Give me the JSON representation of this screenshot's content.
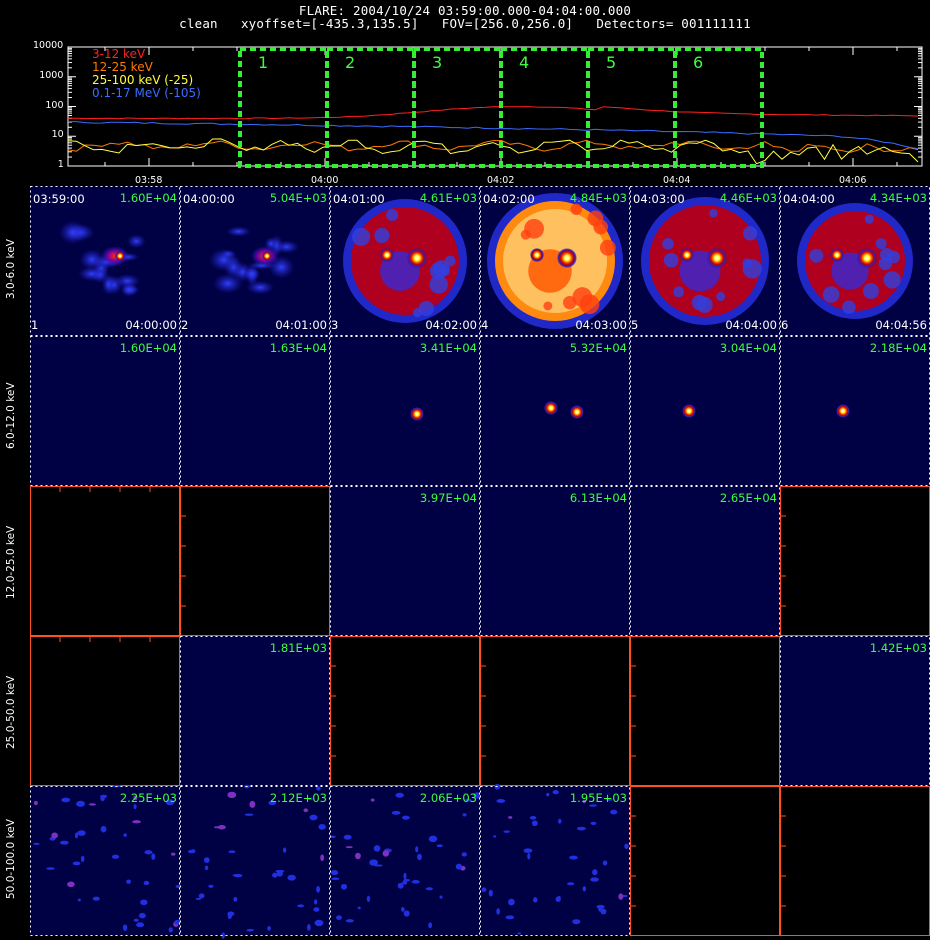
{
  "header": {
    "line1": "FLARE: 2004/10/24 03:59:00.000-04:04:00.000",
    "line2": "clean   xyoffset=[-435.3,135.5]   FOV=[256.0,256.0]   Detectors= 001111111"
  },
  "chart_data": [
    {
      "type": "line",
      "ylim": [
        1,
        10000
      ],
      "yscale": "log",
      "yticks": [
        "10000",
        "1000",
        "100",
        "10",
        "1"
      ],
      "xticks": [
        "03:58",
        "04:00",
        "04:02",
        "04:04",
        "04:06"
      ],
      "series": [
        {
          "name": "3-12 keV",
          "color": "#ff2020"
        },
        {
          "name": "12-25 keV",
          "color": "#ff7a00"
        },
        {
          "name": "25-100 keV (-25)",
          "color": "#ffff40"
        },
        {
          "name": "0.1-17 MeV (-105)",
          "color": "#3a6cff"
        }
      ],
      "windows": [
        "1",
        "2",
        "3",
        "4",
        "5",
        "6"
      ],
      "window_color": "#33ee33"
    },
    {
      "type": "heatmap",
      "row_labels": [
        "3.0-6.0 keV",
        "6.0-12.0 keV",
        "12.0-25.0 keV",
        "25.0-50.0 keV",
        "50.0-100.0 keV"
      ],
      "cells": [
        [
          {
            "peak": "1.60E+04",
            "start": "03:59:00",
            "end": "04:00:00",
            "index": "1"
          },
          {
            "peak": "5.04E+03",
            "start": "04:00:00",
            "end": "04:01:00",
            "index": "2"
          },
          {
            "peak": "4.61E+03",
            "start": "04:01:00",
            "end": "04:02:00",
            "index": "3"
          },
          {
            "peak": "4.84E+03",
            "start": "04:02:00",
            "end": "04:03:00",
            "index": "4"
          },
          {
            "peak": "4.46E+03",
            "start": "04:03:00",
            "end": "04:04:00",
            "index": "5"
          },
          {
            "peak": "4.34E+03",
            "start": "04:04:00",
            "end": "04:04:56",
            "index": "6"
          }
        ],
        [
          {
            "peak": "1.60E+04"
          },
          {
            "peak": "1.63E+04"
          },
          {
            "peak": "3.41E+04"
          },
          {
            "peak": "5.32E+04"
          },
          {
            "peak": "3.04E+04"
          },
          {
            "peak": "2.18E+04"
          }
        ],
        [
          {
            "peak": ""
          },
          {
            "peak": ""
          },
          {
            "peak": "3.97E+04"
          },
          {
            "peak": "6.13E+04"
          },
          {
            "peak": "2.65E+04"
          },
          {
            "peak": ""
          }
        ],
        [
          {
            "peak": ""
          },
          {
            "peak": "1.81E+03"
          },
          {
            "peak": ""
          },
          {
            "peak": ""
          },
          {
            "peak": ""
          },
          {
            "peak": "1.42E+03"
          }
        ],
        [
          {
            "peak": "2.25E+03"
          },
          {
            "peak": "2.12E+03"
          },
          {
            "peak": "2.06E+03"
          },
          {
            "peak": "1.95E+03"
          },
          {
            "peak": ""
          },
          {
            "peak": ""
          }
        ]
      ],
      "empty_axis_ticks": [
        "2",
        "4",
        "6",
        "8"
      ]
    }
  ]
}
